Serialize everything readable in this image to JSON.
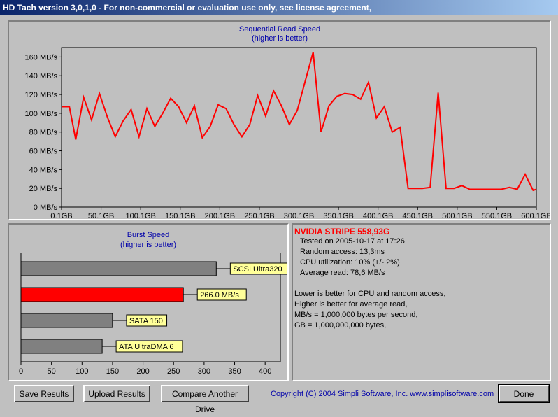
{
  "window": {
    "title": "HD Tach version 3,0,1,0  - For non-commercial or evaluation use only, see license agreement,"
  },
  "seq_chart": {
    "title": "Sequential Read Speed",
    "subtitle": "(higher is better)",
    "y_ticks": [
      "0 MB/s",
      "20 MB/s",
      "40 MB/s",
      "60 MB/s",
      "80 MB/s",
      "100 MB/s",
      "120 MB/s",
      "140 MB/s",
      "160 MB/s"
    ],
    "x_ticks": [
      "0.1GB",
      "50.1GB",
      "100.1GB",
      "150.1GB",
      "200.1GB",
      "250.1GB",
      "300.1GB",
      "350.1GB",
      "400.1GB",
      "450.1GB",
      "500.1GB",
      "550.1GB",
      "600.1GB"
    ],
    "line_color": "#ff0000"
  },
  "burst_chart": {
    "title": "Burst Speed",
    "subtitle": "(higher is better)",
    "x_ticks": [
      "0",
      "50",
      "100",
      "150",
      "200",
      "250",
      "300",
      "350",
      "400"
    ],
    "bars": [
      {
        "label": "SCSI Ultra320",
        "value": 320,
        "color": "#808080"
      },
      {
        "label": "266.0 MB/s",
        "value": 266,
        "color": "#ff0000"
      },
      {
        "label": "SATA 150",
        "value": 150,
        "color": "#808080"
      },
      {
        "label": "ATA UltraDMA 6",
        "value": 133,
        "color": "#808080"
      }
    ]
  },
  "chart_data": [
    {
      "type": "line",
      "title": "Sequential Read Speed",
      "subtitle": "(higher is better)",
      "xlabel": "",
      "ylabel": "",
      "xlim": [
        0.1,
        600.1
      ],
      "ylim": [
        0,
        170
      ],
      "x": [
        0.1,
        10,
        18,
        28,
        38,
        48,
        58,
        68,
        78,
        88,
        98,
        108,
        118,
        128,
        138,
        148,
        158,
        168,
        178,
        188,
        198,
        208,
        218,
        228,
        238,
        248,
        258,
        268,
        278,
        288,
        298,
        308,
        318,
        328,
        338,
        348,
        358,
        368,
        378,
        388,
        398,
        408,
        418,
        428,
        438,
        448,
        456,
        466,
        476,
        486,
        496,
        506,
        516,
        526,
        536,
        546,
        556,
        566,
        576,
        586,
        596,
        600.1
      ],
      "series": [
        {
          "values": [
            107,
            107,
            72,
            117,
            93,
            121,
            96,
            75,
            92,
            104,
            75,
            105,
            86,
            100,
            116,
            107,
            90,
            108,
            74,
            86,
            109,
            105,
            88,
            75,
            88,
            119,
            97,
            124,
            108,
            88,
            103,
            134,
            165,
            80,
            108,
            118,
            121,
            120,
            115,
            133,
            95,
            107,
            80,
            85,
            20,
            20,
            20,
            21,
            122,
            20,
            20,
            23,
            19,
            19,
            19,
            19,
            19,
            21,
            19,
            35,
            18,
            19
          ]
        }
      ],
      "grid": false,
      "legend": "none"
    },
    {
      "type": "bar",
      "title": "Burst Speed",
      "subtitle": "(higher is better)",
      "categories": [
        "SCSI Ultra320",
        "266.0 MB/s",
        "SATA 150",
        "ATA UltraDMA 6"
      ],
      "values": [
        320,
        266,
        150,
        133
      ],
      "xlim": [
        0,
        400
      ],
      "orientation": "horizontal"
    }
  ],
  "info": {
    "drive_name": "NVIDIA STRIPE 558,93G",
    "lines": [
      "Tested on 2005-10-17 at 17:26",
      "Random access: 13,3ms",
      "CPU utilization: 10% (+/- 2%)",
      "Average read: 78,6 MB/s"
    ],
    "notes": [
      "Lower is better for CPU and random access,",
      "Higher is better for average read,",
      "MB/s = 1,000,000 bytes per second,",
      "GB = 1,000,000,000 bytes,"
    ]
  },
  "buttons": {
    "save": "Save Results",
    "upload": "Upload Results",
    "compare": "Compare Another Drive",
    "done": "Done"
  },
  "copyright": "Copyright (C) 2004 Simpli Software, Inc. www.simplisoftware.com"
}
